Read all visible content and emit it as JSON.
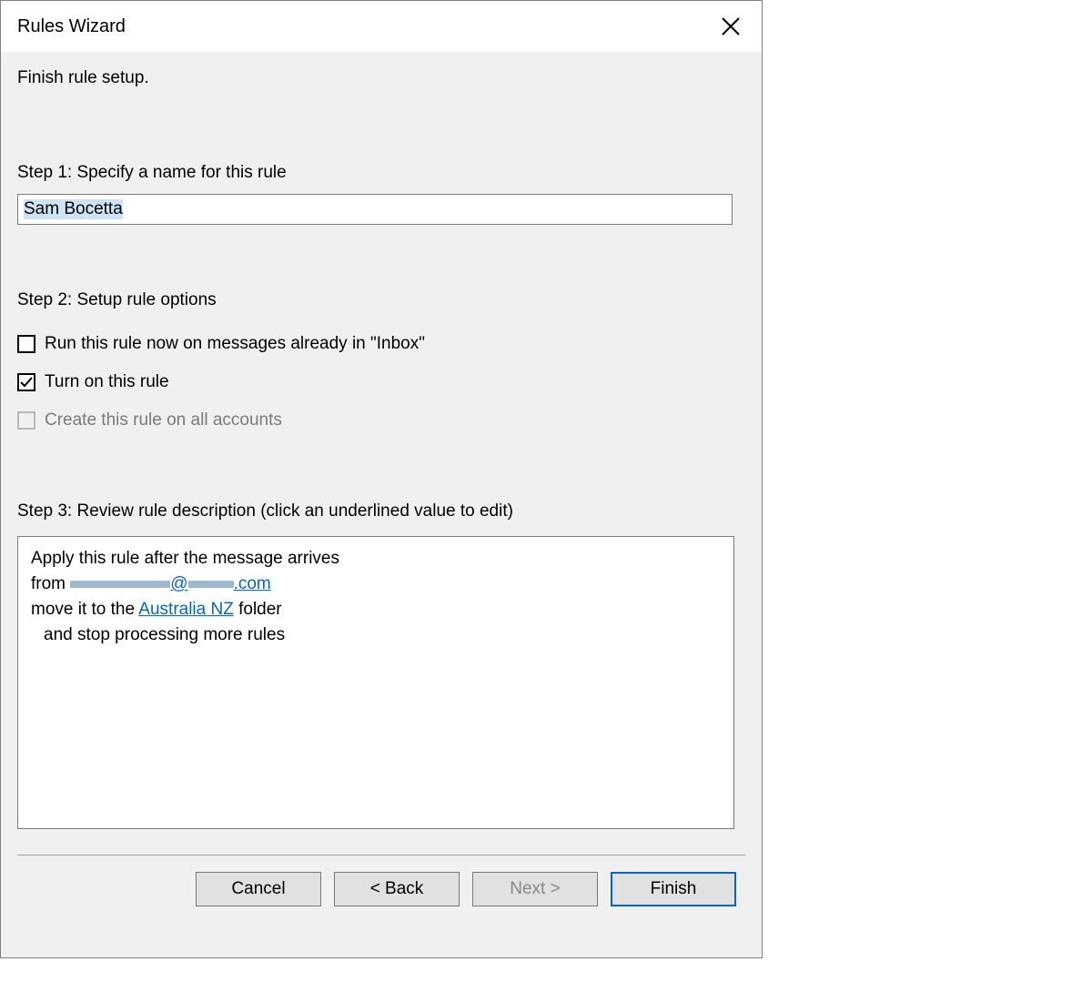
{
  "dialog": {
    "title": "Rules Wizard"
  },
  "heading": "Finish rule setup.",
  "step1": {
    "label": "Step 1: Specify a name for this rule",
    "value": "Sam Bocetta"
  },
  "step2": {
    "label": "Step 2: Setup rule options",
    "options": [
      {
        "label": "Run this rule now on messages already in \"Inbox\"",
        "checked": false,
        "disabled": false
      },
      {
        "label": "Turn on this rule",
        "checked": true,
        "disabled": false
      },
      {
        "label": "Create this rule on all accounts",
        "checked": false,
        "disabled": true
      }
    ]
  },
  "step3": {
    "label": "Step 3: Review rule description (click an underlined value to edit)",
    "line1": "Apply this rule after the message arrives",
    "line2_prefix": "from",
    "line2_at": "@",
    "line2_domain_suffix": ".com",
    "line3_prefix": "move it to the ",
    "line3_link": " Australia NZ",
    "line3_suffix": " folder",
    "line4": "and stop processing more rules"
  },
  "buttons": {
    "cancel": "Cancel",
    "back": "< Back",
    "next": "Next >",
    "finish": "Finish"
  }
}
